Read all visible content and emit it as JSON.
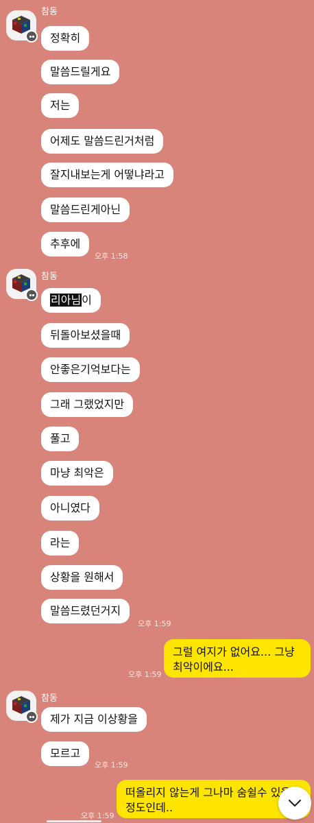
{
  "sender_name": "참동",
  "group1": {
    "messages": [
      "정확히",
      "말씀드릴게요",
      "저는",
      "어제도 말씀드린거처럼",
      "잘지내보는게 어떻냐라고",
      "말씀드린게아닌",
      "추후에"
    ],
    "time": "오후 1:58"
  },
  "group2": {
    "first_highlight": "리아님",
    "first_rest": "이",
    "messages": [
      "뒤돌아보셨을때",
      "안좋은기억보다는",
      "그래 그랬었지만",
      "풀고",
      "마냥 최악은",
      "아니였다",
      "라는",
      "상황을 원해서",
      "말씀드렸던거지"
    ],
    "time": "오후 1:59"
  },
  "out1": {
    "line1": "그럴 여지가 없어요... 그냥",
    "line2": "최악이에요...",
    "time": "오후 1:59"
  },
  "group3": {
    "messages": [
      "제가 지금 이상황을",
      "모르고"
    ],
    "time": "오후 1:59"
  },
  "out2": {
    "line1": "떠올리지 않는게 그나마 숨쉴수 있을",
    "line2": "정도인데..",
    "time": "오후 1:59"
  },
  "colors": {
    "background": "#d8847a",
    "incoming": "#ffffff",
    "outgoing": "#fee500"
  },
  "icons": {
    "scroll_down": "chevron-down-icon",
    "profile_badge": "grid-badge-icon"
  }
}
